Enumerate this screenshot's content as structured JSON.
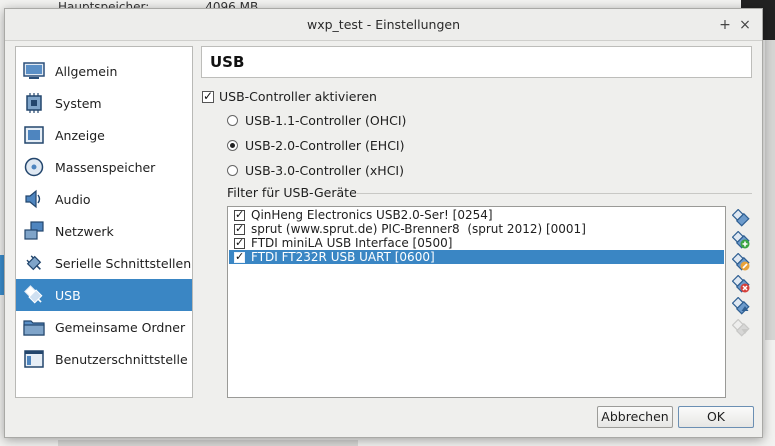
{
  "background": {
    "strip_label": "Hauptspeicher:",
    "strip_value": "4096 MB"
  },
  "window": {
    "title": "wxp_test - Einstellungen",
    "controls": [
      "+",
      "×"
    ]
  },
  "sidebar": {
    "items": [
      {
        "label": "Allgemein",
        "icon": "general-icon"
      },
      {
        "label": "System",
        "icon": "system-chip-icon"
      },
      {
        "label": "Anzeige",
        "icon": "display-icon"
      },
      {
        "label": "Massenspeicher",
        "icon": "storage-disk-icon"
      },
      {
        "label": "Audio",
        "icon": "audio-speaker-icon"
      },
      {
        "label": "Netzwerk",
        "icon": "network-icon"
      },
      {
        "label": "Serielle Schnittstellen",
        "icon": "serial-plug-icon"
      },
      {
        "label": "USB",
        "icon": "usb-icon",
        "selected": true
      },
      {
        "label": "Gemeinsame Ordner",
        "icon": "shared-folder-icon"
      },
      {
        "label": "Benutzerschnittstelle",
        "icon": "user-interface-icon"
      }
    ]
  },
  "main": {
    "section_title": "USB",
    "enable_usb": {
      "label": "USB-Controller aktivieren",
      "checked": true
    },
    "controllers": [
      {
        "label": "USB-1.1-Controller (OHCI)",
        "selected": false
      },
      {
        "label": "USB-2.0-Controller (EHCI)",
        "selected": true
      },
      {
        "label": "USB-3.0-Controller (xHCI)",
        "selected": false
      }
    ],
    "filter_title": "Filter für USB-Geräte",
    "filters": [
      {
        "label": "QinHeng Electronics USB2.0-Ser! [0254]",
        "checked": true,
        "selected": false
      },
      {
        "label": "sprut (www.sprut.de) PIC-Brenner8  (sprut 2012) [0001]",
        "checked": true,
        "selected": false
      },
      {
        "label": "FTDI miniLA USB Interface [0500]",
        "checked": true,
        "selected": false
      },
      {
        "label": "FTDI FT232R USB UART [0600]",
        "checked": true,
        "selected": true
      }
    ],
    "filter_tools": [
      "add-filter-icon",
      "add-from-device-icon",
      "edit-filter-icon",
      "remove-filter-icon",
      "move-up-icon",
      "move-down-icon"
    ]
  },
  "buttons": {
    "cancel": "Abbrechen",
    "ok": "OK"
  },
  "colors": {
    "selection": "#3a86c4",
    "dialog_bg": "#efefed"
  }
}
